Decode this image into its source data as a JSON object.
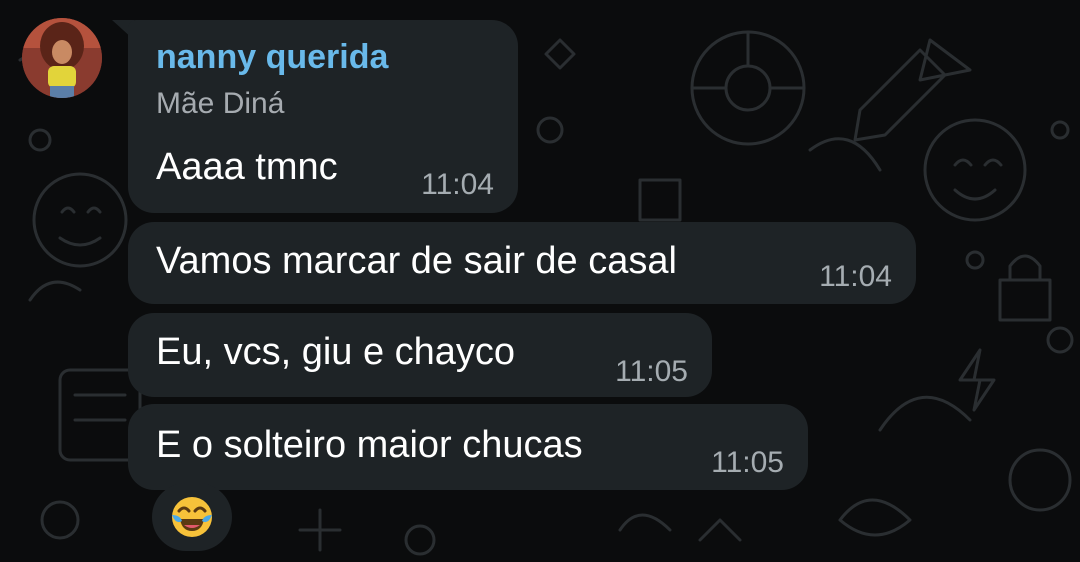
{
  "chat": {
    "sender_name": "nanny querida",
    "forwarded_from": "Mãe Diná",
    "messages": [
      {
        "text": "Aaaa tmnc",
        "time": "11:04"
      },
      {
        "text": "Vamos marcar de sair de casal",
        "time": "11:04"
      },
      {
        "text": "Eu, vcs, giu e chayco",
        "time": "11:05"
      },
      {
        "text": "E o solteiro maior chucas",
        "time": "11:05"
      }
    ],
    "reaction": {
      "icon": "face-with-tears-of-joy-emoji"
    }
  },
  "colors": {
    "background": "#0b0c0d",
    "bubble": "#1e2326",
    "sender_name": "#69b9ea",
    "time": "#a5acb1"
  }
}
